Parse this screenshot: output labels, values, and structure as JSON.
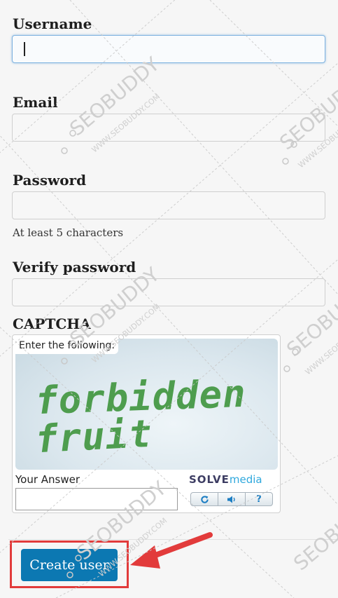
{
  "form": {
    "username_label": "Username",
    "username_value": "",
    "email_label": "Email",
    "email_value": "",
    "password_label": "Password",
    "password_value": "",
    "password_hint": "At least 5 characters",
    "verify_label": "Verify password",
    "verify_value": ""
  },
  "captcha": {
    "heading": "CAPTCHA",
    "instruction": "Enter the following:",
    "challenge_line1": "forbidden",
    "challenge_line2": "fruit",
    "answer_label": "Your Answer",
    "answer_value": "",
    "brand_part1": "SOLVE",
    "brand_part2": "media",
    "controls": {
      "refresh_icon": "refresh-icon",
      "audio_icon": "speaker-icon",
      "help_label": "?"
    }
  },
  "actions": {
    "create_label": "Create user"
  },
  "watermark": {
    "text": "SEOBUDDY",
    "url": "WWW.SEOBUDDY.COM"
  },
  "colors": {
    "button": "#0c78b2",
    "annotation_red": "#e23b3b",
    "captcha_text_green": "#4e9d4e",
    "focus_blue": "#7fb3e0"
  }
}
